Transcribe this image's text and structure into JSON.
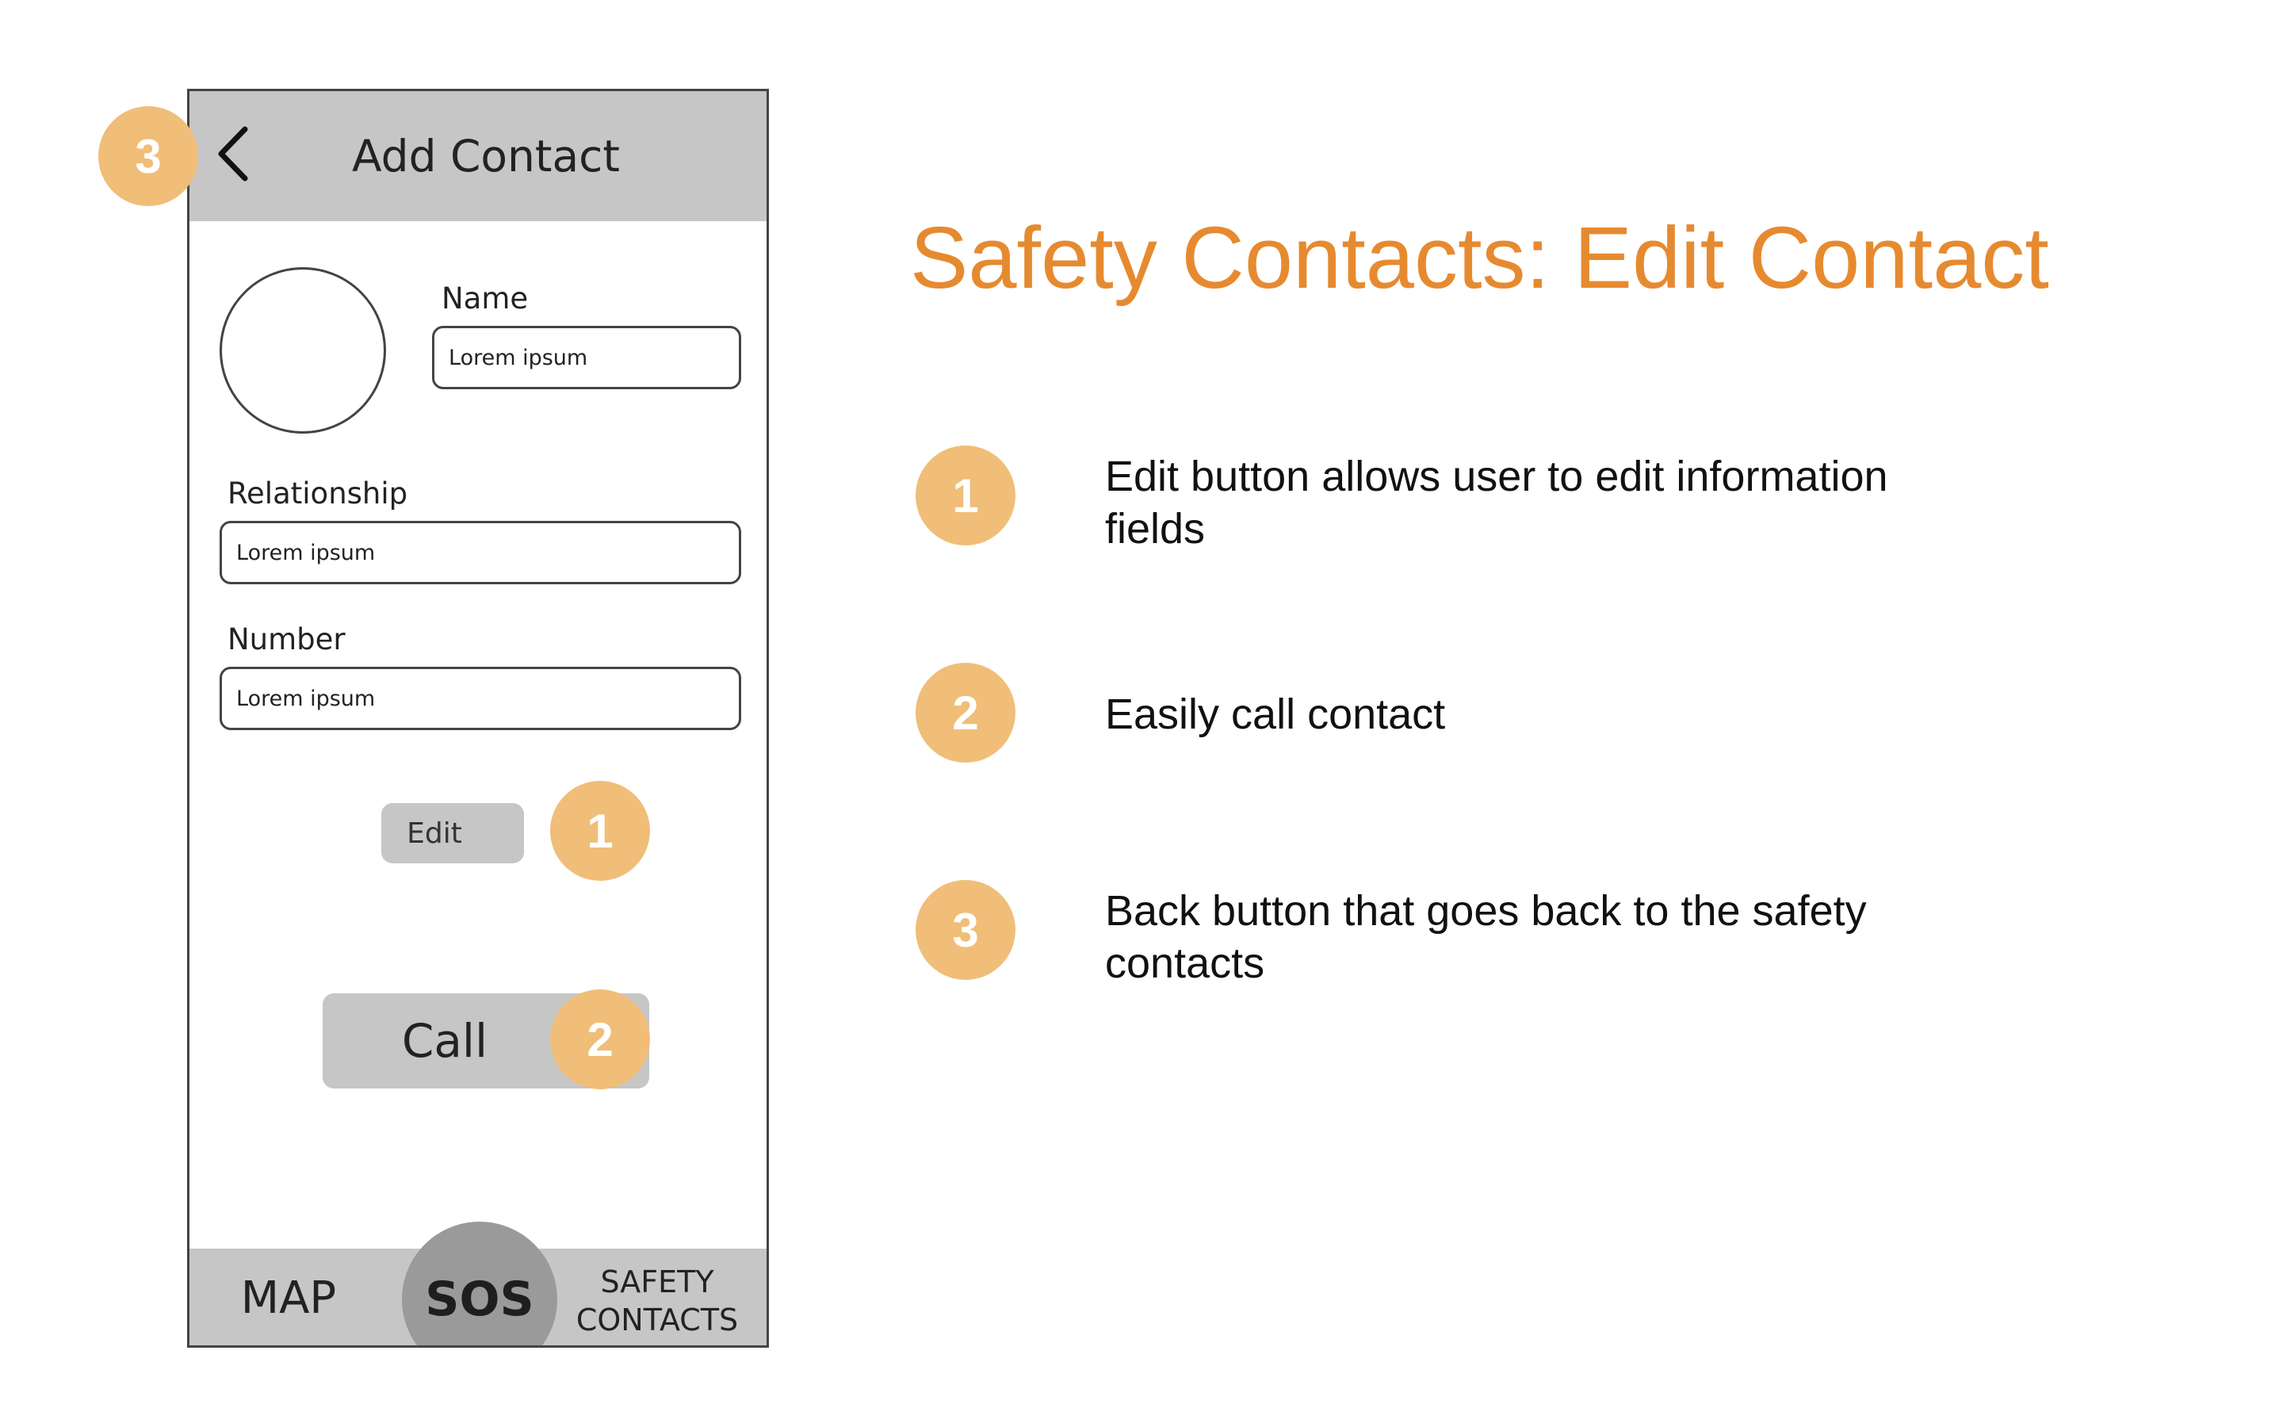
{
  "phone": {
    "header_title": "Add Contact",
    "fields": {
      "name_label": "Name",
      "name_value": "Lorem ipsum",
      "relationship_label": "Relationship",
      "relationship_value": "Lorem ipsum",
      "number_label": "Number",
      "number_value": "Lorem ipsum"
    },
    "edit_label": "Edit",
    "call_label": "Call",
    "nav": {
      "map_label": "MAP",
      "sos_label": "SOS",
      "safety_line1": "SAFETY",
      "safety_line2": "CONTACTS"
    }
  },
  "annotations": {
    "title": "Safety Contacts: Edit Contact",
    "items": [
      {
        "number": "1",
        "text": "Edit button allows user to edit information fields"
      },
      {
        "number": "2",
        "text": "Easily call contact"
      },
      {
        "number": "3",
        "text": "Back button that goes back to the safety contacts"
      }
    ]
  },
  "colors": {
    "accent": "#e68a30",
    "badge": "#f0be78",
    "header_gray": "#c6c6c6",
    "sos_gray": "#9a9a9a"
  },
  "icons": {
    "back": "chevron-left-icon"
  }
}
